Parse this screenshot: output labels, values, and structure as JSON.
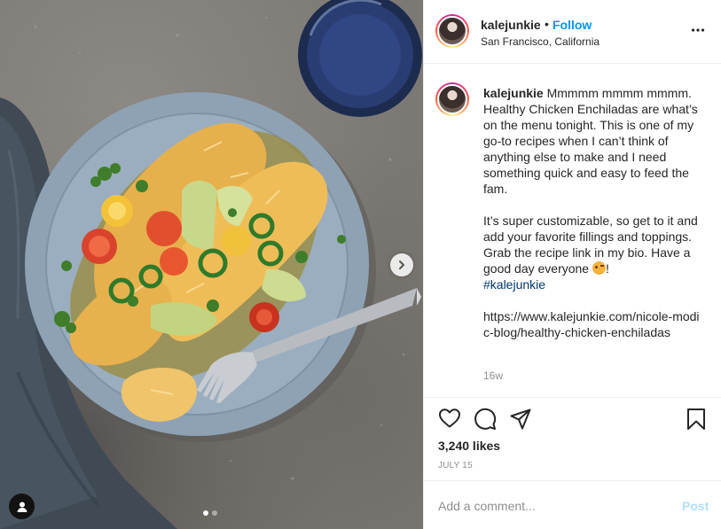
{
  "post": {
    "username": "kalejunkie",
    "follow_dot": "•",
    "follow_label": "Follow",
    "location": "San Francisco, California",
    "more_icon": "more-options-icon"
  },
  "caption": {
    "username": "kalejunkie",
    "line1": "Mmmmm mmmm mmmm. Healthy Chicken Enchiladas are what’s on the menu tonight. This is one of my go-to recipes when I can’t think of anything else to make and I need something quick and easy to feed the fam.",
    "line2": "It’s super customizable, so get to it and add your favorite fillings and toppings. Grab the recipe link in my bio. Have a good day everyone",
    "emoji": "face-blowing-kiss",
    "exclaim": "!",
    "hashtag": "#kalejunkie",
    "link": "https://www.kalejunkie.com/nicole-modic-blog/healthy-chicken-enchiladas",
    "time": "16w"
  },
  "actions": {
    "likes": "3,240 likes",
    "date": "JULY 15",
    "icons": [
      "heart-icon",
      "comment-icon",
      "share-icon",
      "bookmark-icon"
    ]
  },
  "comment_box": {
    "placeholder": "Add a comment...",
    "post_label": "Post"
  },
  "carousel": {
    "total": 2,
    "current": 1
  },
  "colors": {
    "link_blue": "#0095f6",
    "hashtag_blue": "#00376b",
    "post_disabled": "#b2dffc",
    "muted": "#8e8e8e"
  }
}
